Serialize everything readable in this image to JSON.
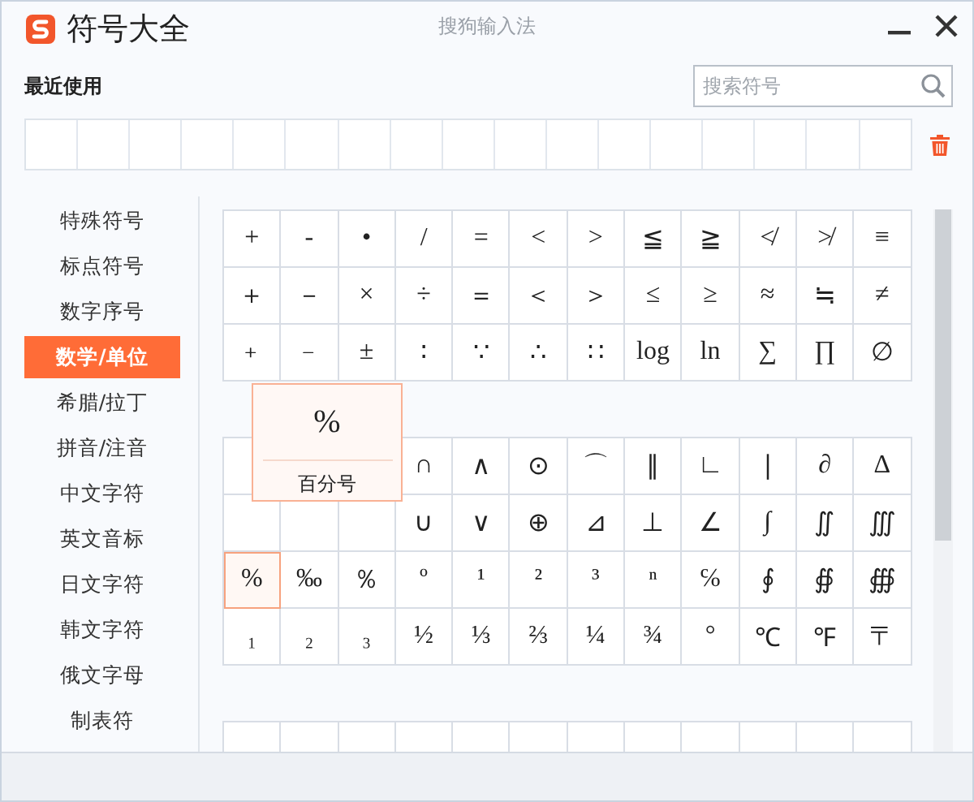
{
  "window": {
    "title": "符号大全",
    "app_name": "搜狗输入法"
  },
  "recent": {
    "label": "最近使用"
  },
  "search": {
    "placeholder": "搜索符号"
  },
  "categories": [
    {
      "label": "特殊符号",
      "selected": false
    },
    {
      "label": "标点符号",
      "selected": false
    },
    {
      "label": "数字序号",
      "selected": false
    },
    {
      "label": "数学/单位",
      "selected": true
    },
    {
      "label": "希腊/拉丁",
      "selected": false
    },
    {
      "label": "拼音/注音",
      "selected": false
    },
    {
      "label": "中文字符",
      "selected": false
    },
    {
      "label": "英文音标",
      "selected": false
    },
    {
      "label": "日文字符",
      "selected": false
    },
    {
      "label": "韩文字符",
      "selected": false
    },
    {
      "label": "俄文字母",
      "selected": false
    },
    {
      "label": "制表符",
      "selected": false
    }
  ],
  "groups": [
    {
      "rows": [
        [
          {
            "symbol": "+",
            "selected": false
          },
          {
            "symbol": "-",
            "selected": false
          },
          {
            "symbol": "•",
            "selected": false
          },
          {
            "symbol": "/",
            "selected": false
          },
          {
            "symbol": "=",
            "selected": false
          },
          {
            "symbol": "<",
            "selected": false
          },
          {
            "symbol": ">",
            "selected": false
          },
          {
            "symbol": "≦",
            "selected": false
          },
          {
            "symbol": "≧",
            "selected": false
          },
          {
            "symbol": "≮",
            "selected": false
          },
          {
            "symbol": "≯",
            "selected": false
          },
          {
            "symbol": "≡",
            "selected": false
          }
        ],
        [
          {
            "symbol": "＋",
            "selected": false
          },
          {
            "symbol": "－",
            "selected": false
          },
          {
            "symbol": "×",
            "selected": false
          },
          {
            "symbol": "÷",
            "selected": false
          },
          {
            "symbol": "＝",
            "selected": false
          },
          {
            "symbol": "＜",
            "selected": false
          },
          {
            "symbol": "＞",
            "selected": false
          },
          {
            "symbol": "≤",
            "selected": false
          },
          {
            "symbol": "≥",
            "selected": false
          },
          {
            "symbol": "≈",
            "selected": false
          },
          {
            "symbol": "≒",
            "selected": false
          },
          {
            "symbol": "≠",
            "selected": false
          }
        ],
        [
          {
            "symbol": "﹢",
            "selected": false
          },
          {
            "symbol": "﹣",
            "selected": false
          },
          {
            "symbol": "±",
            "selected": false
          },
          {
            "symbol": "∶",
            "selected": false
          },
          {
            "symbol": "∵",
            "selected": false
          },
          {
            "symbol": "∴",
            "selected": false
          },
          {
            "symbol": "∷",
            "selected": false
          },
          {
            "symbol": "log",
            "selected": false
          },
          {
            "symbol": "ln",
            "selected": false
          },
          {
            "symbol": "∑",
            "selected": false
          },
          {
            "symbol": "∏",
            "selected": false
          },
          {
            "symbol": "∅",
            "selected": false
          }
        ]
      ]
    },
    {
      "rows": [
        [
          null,
          null,
          null,
          {
            "symbol": "∩",
            "selected": false
          },
          {
            "symbol": "∧",
            "selected": false
          },
          {
            "symbol": "⊙",
            "selected": false
          },
          {
            "symbol": "⌒",
            "selected": false
          },
          {
            "symbol": "∥",
            "selected": false
          },
          {
            "symbol": "∟",
            "selected": false
          },
          {
            "symbol": "∣",
            "selected": false
          },
          {
            "symbol": "∂",
            "selected": false
          },
          {
            "symbol": "∆",
            "selected": false
          }
        ],
        [
          null,
          null,
          null,
          {
            "symbol": "∪",
            "selected": false
          },
          {
            "symbol": "∨",
            "selected": false
          },
          {
            "symbol": "⊕",
            "selected": false
          },
          {
            "symbol": "⊿",
            "selected": false
          },
          {
            "symbol": "⊥",
            "selected": false
          },
          {
            "symbol": "∠",
            "selected": false
          },
          {
            "symbol": "∫",
            "selected": false
          },
          {
            "symbol": "∬",
            "selected": false
          },
          {
            "symbol": "∭",
            "selected": false
          }
        ],
        [
          {
            "symbol": "%",
            "selected": true
          },
          {
            "symbol": "‰",
            "selected": false
          },
          {
            "symbol": "％",
            "selected": false
          },
          {
            "symbol": "º",
            "selected": false
          },
          {
            "symbol": "¹",
            "selected": false
          },
          {
            "symbol": "²",
            "selected": false
          },
          {
            "symbol": "³",
            "selected": false
          },
          {
            "symbol": "ⁿ",
            "selected": false
          },
          {
            "symbol": "℅",
            "selected": false
          },
          {
            "symbol": "∮",
            "selected": false
          },
          {
            "symbol": "∯",
            "selected": false
          },
          {
            "symbol": "∰",
            "selected": false
          }
        ],
        [
          {
            "symbol": "₁",
            "selected": false
          },
          {
            "symbol": "₂",
            "selected": false
          },
          {
            "symbol": "₃",
            "selected": false
          },
          {
            "symbol": "½",
            "selected": false
          },
          {
            "symbol": "⅓",
            "selected": false
          },
          {
            "symbol": "⅔",
            "selected": false
          },
          {
            "symbol": "¼",
            "selected": false
          },
          {
            "symbol": "¾",
            "selected": false
          },
          {
            "symbol": "°",
            "selected": false
          },
          {
            "symbol": "℃",
            "selected": false
          },
          {
            "symbol": "℉",
            "selected": false
          },
          {
            "symbol": "〒",
            "selected": false
          }
        ]
      ]
    }
  ],
  "tooltip": {
    "symbol": "%",
    "name": "百分号"
  }
}
